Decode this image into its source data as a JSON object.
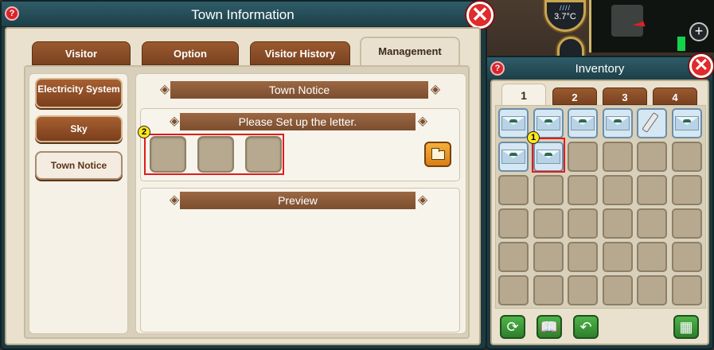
{
  "town_window": {
    "title": "Town Information",
    "help_label": "?",
    "close_label": "✕",
    "tabs": [
      {
        "label": "Visitor",
        "active": false
      },
      {
        "label": "Option",
        "active": false
      },
      {
        "label": "Visitor History",
        "active": false
      },
      {
        "label": "Management",
        "active": true
      }
    ],
    "side_buttons": [
      {
        "label": "Electricity System",
        "active": false
      },
      {
        "label": "Sky",
        "active": false
      },
      {
        "label": "Town Notice",
        "active": true
      }
    ],
    "main": {
      "header": "Town Notice",
      "letter_prompt": "Please Set up the letter.",
      "preview_label": "Preview",
      "letter_slot_count": 3
    }
  },
  "annotations": {
    "marker_1": "1",
    "marker_2": "2"
  },
  "hud": {
    "temperature": "3.7°C",
    "zoom_in_label": "+"
  },
  "inventory": {
    "title": "Inventory",
    "help_label": "?",
    "close_label": "✕",
    "tabs": [
      {
        "label": "1",
        "active": true
      },
      {
        "label": "2",
        "active": false
      },
      {
        "label": "3",
        "active": false
      },
      {
        "label": "4",
        "active": false
      }
    ],
    "grid_columns": 6,
    "grid_rows": 6,
    "items": [
      {
        "slot": 0,
        "icon": "envelope-icon"
      },
      {
        "slot": 1,
        "icon": "envelope-icon"
      },
      {
        "slot": 2,
        "icon": "envelope-icon"
      },
      {
        "slot": 3,
        "icon": "envelope-icon"
      },
      {
        "slot": 4,
        "icon": "pen-icon"
      },
      {
        "slot": 5,
        "icon": "open-envelope-icon"
      },
      {
        "slot": 6,
        "icon": "open-envelope-icon"
      },
      {
        "slot": 7,
        "icon": "envelope-icon"
      }
    ],
    "bottom_buttons": [
      "refresh-icon",
      "book-icon",
      "undo-icon",
      "grid-select-icon"
    ]
  },
  "colors": {
    "window_frame": "#1d3940",
    "panel_bg": "#e9e1cd",
    "tab_brown": "#8a4e28",
    "highlight_red": "#e21b1b",
    "marker_yellow": "#ffe71a",
    "green_button": "#3f9b3b"
  }
}
